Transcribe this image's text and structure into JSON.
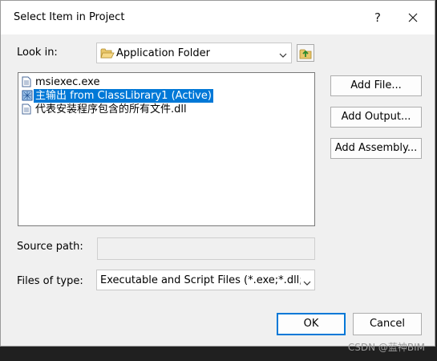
{
  "window": {
    "title": "Select Item in Project",
    "help_label": "?"
  },
  "look_in": {
    "label": "Look in:",
    "value": "Application Folder",
    "icon": "open-folder-icon",
    "up_icon": "up-one-level-icon"
  },
  "files": {
    "items": [
      {
        "name": "msiexec.exe",
        "icon": "file-icon",
        "selected": false
      },
      {
        "name": "主输出 from ClassLibrary1 (Active)",
        "icon": "output-icon",
        "selected": true
      },
      {
        "name": "代表安装程序包含的所有文件.dll",
        "icon": "file-icon",
        "selected": false
      }
    ]
  },
  "side_buttons": {
    "add_file": "Add File...",
    "add_output": "Add Output...",
    "add_assembly": "Add Assembly..."
  },
  "source_path": {
    "label": "Source path:",
    "value": ""
  },
  "files_of_type": {
    "label": "Files of type:",
    "value": "Executable and Script Files (*.exe;*.dll;*.vbs;"
  },
  "footer": {
    "ok_label": "OK",
    "cancel_label": "Cancel"
  },
  "watermark": "CSDN @蓝神BIM",
  "colors": {
    "selection": "#0078d7",
    "dialog_bg": "#f0f0f0",
    "default_button_border": "#0078d7"
  }
}
